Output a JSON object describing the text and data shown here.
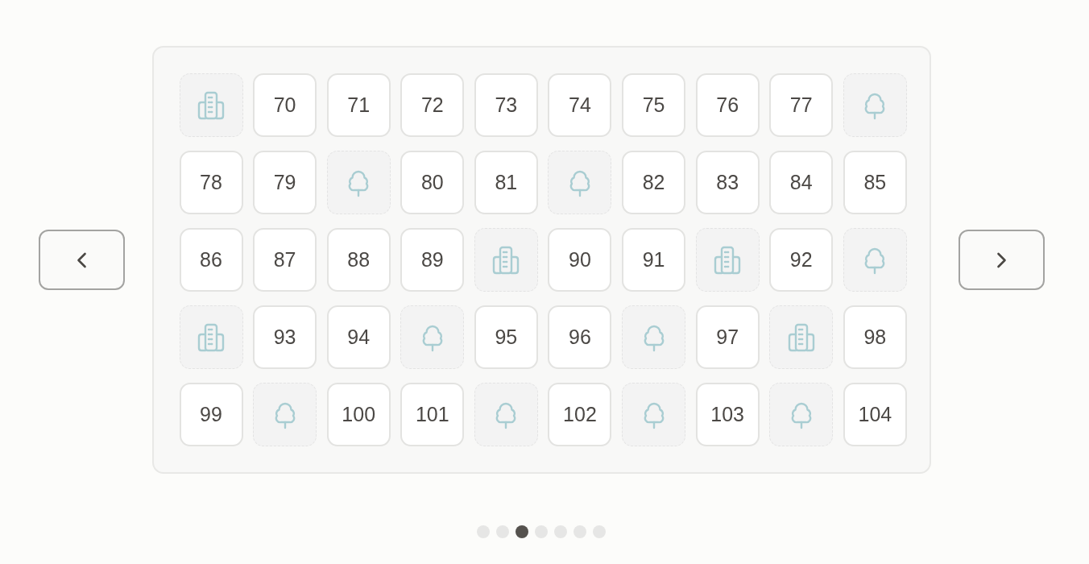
{
  "grid": {
    "cells": [
      {
        "kind": "building"
      },
      {
        "kind": "number",
        "label": "70"
      },
      {
        "kind": "number",
        "label": "71"
      },
      {
        "kind": "number",
        "label": "72"
      },
      {
        "kind": "number",
        "label": "73"
      },
      {
        "kind": "number",
        "label": "74"
      },
      {
        "kind": "number",
        "label": "75"
      },
      {
        "kind": "number",
        "label": "76"
      },
      {
        "kind": "number",
        "label": "77"
      },
      {
        "kind": "tree"
      },
      {
        "kind": "number",
        "label": "78"
      },
      {
        "kind": "number",
        "label": "79"
      },
      {
        "kind": "tree"
      },
      {
        "kind": "number",
        "label": "80"
      },
      {
        "kind": "number",
        "label": "81"
      },
      {
        "kind": "tree"
      },
      {
        "kind": "number",
        "label": "82"
      },
      {
        "kind": "number",
        "label": "83"
      },
      {
        "kind": "number",
        "label": "84"
      },
      {
        "kind": "number",
        "label": "85"
      },
      {
        "kind": "number",
        "label": "86"
      },
      {
        "kind": "number",
        "label": "87"
      },
      {
        "kind": "number",
        "label": "88"
      },
      {
        "kind": "number",
        "label": "89"
      },
      {
        "kind": "building"
      },
      {
        "kind": "number",
        "label": "90"
      },
      {
        "kind": "number",
        "label": "91"
      },
      {
        "kind": "building"
      },
      {
        "kind": "number",
        "label": "92"
      },
      {
        "kind": "tree"
      },
      {
        "kind": "building"
      },
      {
        "kind": "number",
        "label": "93"
      },
      {
        "kind": "number",
        "label": "94"
      },
      {
        "kind": "tree"
      },
      {
        "kind": "number",
        "label": "95"
      },
      {
        "kind": "number",
        "label": "96"
      },
      {
        "kind": "tree"
      },
      {
        "kind": "number",
        "label": "97"
      },
      {
        "kind": "building"
      },
      {
        "kind": "number",
        "label": "98"
      },
      {
        "kind": "number",
        "label": "99"
      },
      {
        "kind": "tree"
      },
      {
        "kind": "number",
        "label": "100"
      },
      {
        "kind": "number",
        "label": "101"
      },
      {
        "kind": "tree"
      },
      {
        "kind": "number",
        "label": "102"
      },
      {
        "kind": "tree"
      },
      {
        "kind": "number",
        "label": "103"
      },
      {
        "kind": "tree"
      },
      {
        "kind": "number",
        "label": "104"
      }
    ]
  },
  "pagination": {
    "dots": [
      {
        "selected": false
      },
      {
        "selected": false
      },
      {
        "selected": true
      },
      {
        "selected": false
      },
      {
        "selected": false
      },
      {
        "selected": false
      },
      {
        "selected": false
      }
    ]
  }
}
